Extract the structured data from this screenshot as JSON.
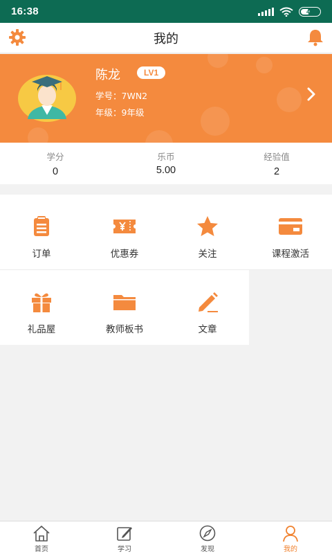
{
  "status_bar": {
    "time": "16:38",
    "battery": "44"
  },
  "header": {
    "title": "我的"
  },
  "profile": {
    "name": "陈龙",
    "level": "LV1",
    "student_id": "学号：7WN2",
    "grade": "年级：9年级"
  },
  "stats": [
    {
      "label": "学分",
      "value": "0"
    },
    {
      "label": "乐币",
      "value": "5.00"
    },
    {
      "label": "经验值",
      "value": "2"
    }
  ],
  "menu": [
    {
      "label": "订单",
      "icon": "clipboard-icon"
    },
    {
      "label": "优惠券",
      "icon": "coupon-icon"
    },
    {
      "label": "关注",
      "icon": "star-icon"
    },
    {
      "label": "课程激活",
      "icon": "card-icon"
    },
    {
      "label": "礼品屋",
      "icon": "gift-icon"
    },
    {
      "label": "教师板书",
      "icon": "folder-icon"
    },
    {
      "label": "文章",
      "icon": "pen-icon"
    }
  ],
  "tabs": [
    {
      "label": "首页",
      "icon": "home-icon"
    },
    {
      "label": "学习",
      "icon": "study-icon"
    },
    {
      "label": "发现",
      "icon": "compass-icon"
    },
    {
      "label": "我的",
      "icon": "person-icon",
      "active": true
    }
  ],
  "colors": {
    "accent": "#f48a3e",
    "status_bar": "#0d6b53"
  }
}
